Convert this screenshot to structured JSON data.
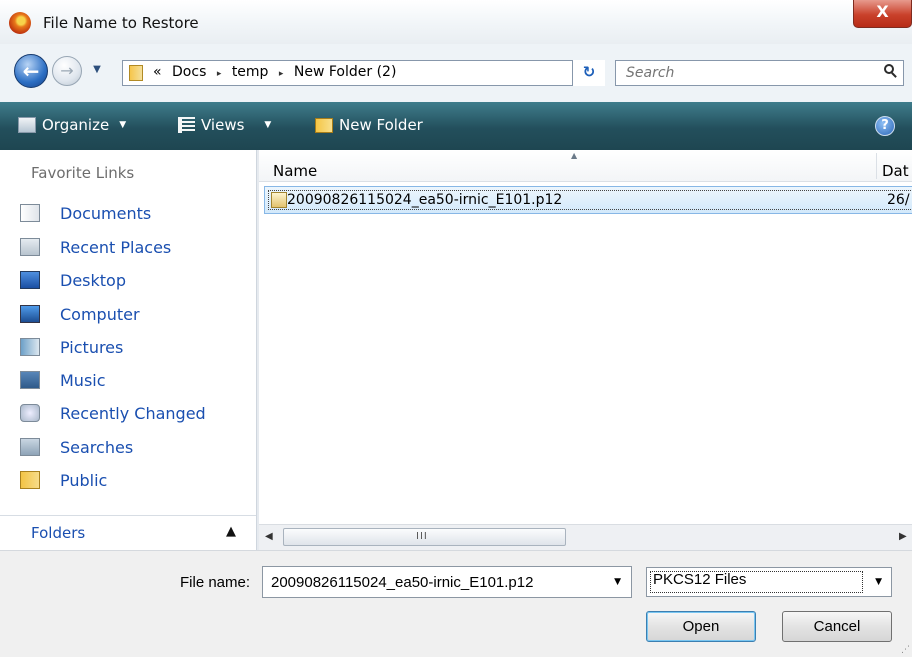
{
  "window": {
    "title": "File Name to Restore",
    "close_label": "X"
  },
  "address": {
    "crumbs": [
      "«",
      "Docs",
      "▸",
      "temp",
      "▸",
      "New Folder (2)"
    ],
    "search_placeholder": "Search"
  },
  "toolbar": {
    "organize_label": "Organize",
    "views_label": "Views",
    "new_folder_label": "New Folder",
    "help_label": "?"
  },
  "nav": {
    "heading": "Favorite Links",
    "items": [
      {
        "label": "Documents",
        "icon": "documents-icon"
      },
      {
        "label": "Recent Places",
        "icon": "recent-places-icon"
      },
      {
        "label": "Desktop",
        "icon": "desktop-icon"
      },
      {
        "label": "Computer",
        "icon": "computer-icon"
      },
      {
        "label": "Pictures",
        "icon": "pictures-icon"
      },
      {
        "label": "Music",
        "icon": "music-icon"
      },
      {
        "label": "Recently Changed",
        "icon": "recently-changed-icon"
      },
      {
        "label": "Searches",
        "icon": "searches-icon"
      },
      {
        "label": "Public",
        "icon": "public-icon"
      }
    ],
    "folders_label": "Folders"
  },
  "list": {
    "columns": [
      "Name",
      "Dat"
    ],
    "rows": [
      {
        "name": "20090826115024_ea50-irnic_E101.p12",
        "date": "26/"
      }
    ],
    "scroll_grip": "III"
  },
  "form": {
    "filename_label": "File name:",
    "filename_value": "20090826115024_ea50-irnic_E101.p12",
    "filetype_value": "PKCS12 Files",
    "open_label": "Open",
    "cancel_label": "Cancel"
  },
  "colors": {
    "link_blue": "#1a4fb0",
    "command_bar": "#234f5c",
    "selection": "#d3e9fb"
  }
}
